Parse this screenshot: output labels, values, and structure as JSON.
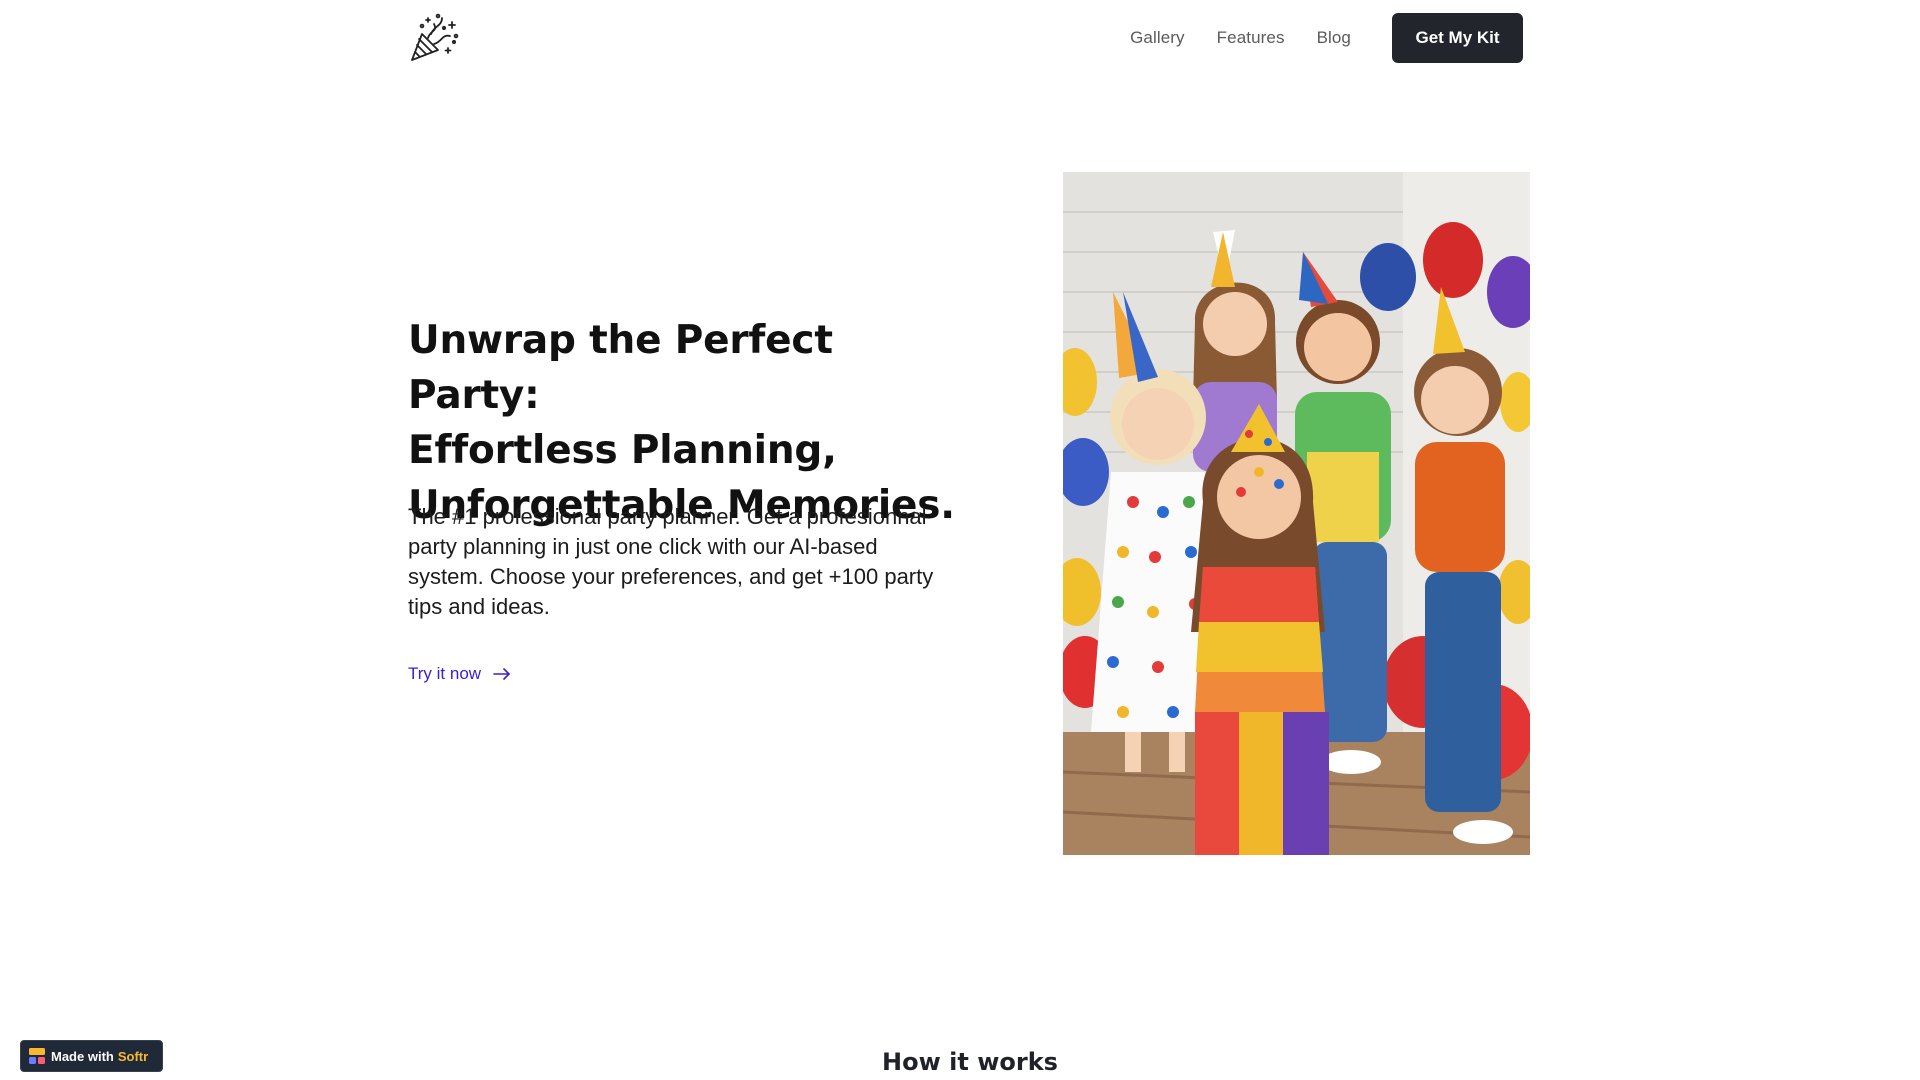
{
  "header": {
    "logo_icon": "party-popper-icon",
    "nav": [
      {
        "label": "Gallery"
      },
      {
        "label": "Features"
      },
      {
        "label": "Blog"
      }
    ],
    "cta_label": "Get My Kit"
  },
  "hero": {
    "title_lines": [
      "Unwrap the Perfect Party:",
      "Effortless Planning,",
      "Unforgettable Memories."
    ],
    "description": "The #1 professional party planner. Get a profesionnal party planning in just one click with our AI-based system. Choose your preferences, and get +100 party tips and ideas.",
    "link_label": "Try it now",
    "link_icon": "arrow-right-icon",
    "link_color": "#3b1ed4"
  },
  "how_it_works": {
    "title": "How it works"
  },
  "badge": {
    "prefix": "Made with",
    "brand": "Softr"
  },
  "colors": {
    "cta_bg": "#22262c",
    "badge_bg": "#1f2937",
    "badge_brand": "#f8b931"
  }
}
